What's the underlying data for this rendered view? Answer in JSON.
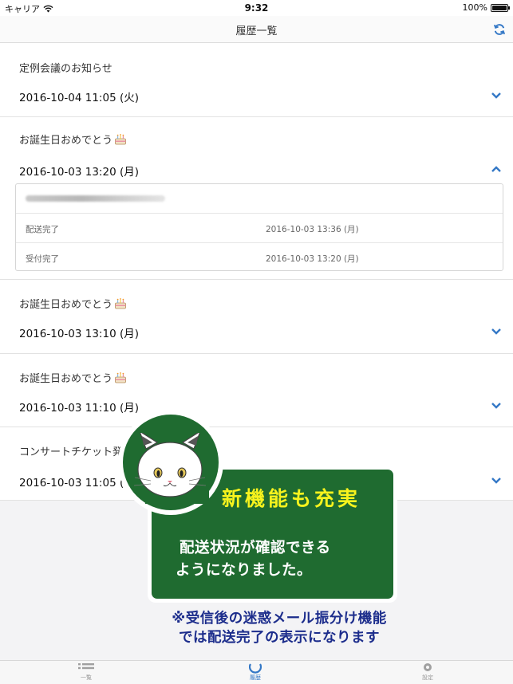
{
  "status_bar": {
    "carrier": "キャリア",
    "time": "9:32",
    "battery": "100%"
  },
  "navbar": {
    "title": "履歴一覧",
    "refresh_icon": "refresh-icon"
  },
  "history": [
    {
      "title": "定例会議のお知らせ",
      "has_cake": false,
      "date": "2016-10-04 11:05 (火)",
      "expanded": false
    },
    {
      "title": "お誕生日おめでとう",
      "has_cake": true,
      "date": "2016-10-03 13:20 (月)",
      "expanded": true,
      "detail": {
        "rows": [
          {
            "label": "配送完了",
            "value": "2016-10-03 13:36 (月)"
          },
          {
            "label": "受付完了",
            "value": "2016-10-03 13:20 (月)"
          }
        ]
      }
    },
    {
      "title": "お誕生日おめでとう",
      "has_cake": true,
      "date": "2016-10-03 13:10 (月)",
      "expanded": false
    },
    {
      "title": "お誕生日おめでとう",
      "has_cake": true,
      "date": "2016-10-03 11:10 (月)",
      "expanded": false
    },
    {
      "title": "コンサートチケット発",
      "has_cake": false,
      "date": "2016-10-03 11:05 (月",
      "expanded": false
    }
  ],
  "tabs": [
    {
      "label": "一覧",
      "icon": "list-icon",
      "active": false
    },
    {
      "label": "履歴",
      "icon": "history-icon",
      "active": true
    },
    {
      "label": "設定",
      "icon": "gear-icon",
      "active": false
    }
  ],
  "promo": {
    "headline": "新機能も充実",
    "body_lines": [
      "配送状況が確認できる",
      "ようになりました。"
    ],
    "note_lines": [
      "※受信後の迷惑メール振分け機能",
      "では配送完了の表示になります"
    ],
    "sign_color": "#1f6b30",
    "headline_color": "#f7f31d",
    "note_color": "#1c2d8c"
  },
  "colors": {
    "accent": "#3478c6"
  }
}
